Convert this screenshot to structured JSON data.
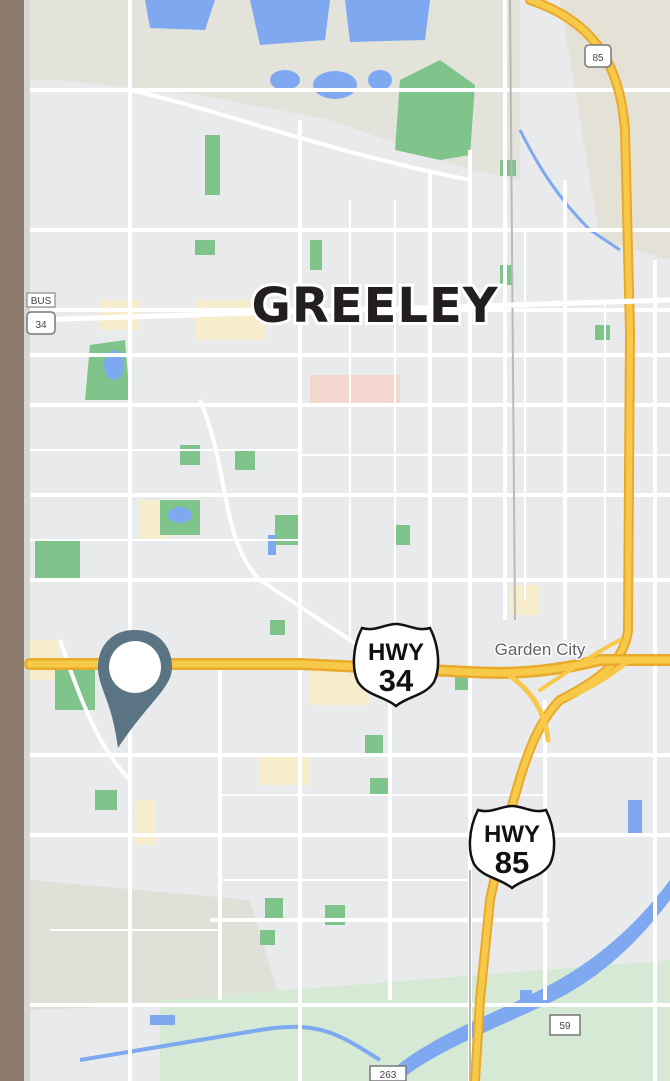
{
  "map": {
    "city_label": "GREELEY",
    "place_labels": [
      {
        "text": "Garden City"
      }
    ],
    "highway_shields": [
      {
        "prefix": "HWY",
        "number": "34"
      },
      {
        "prefix": "HWY",
        "number": "85"
      }
    ],
    "mini_shields": [
      {
        "text": "85"
      },
      {
        "text": "34"
      },
      {
        "text": "BUS"
      },
      {
        "text": "59"
      },
      {
        "text": "263"
      }
    ],
    "marker": {
      "icon": "location-pin-icon"
    },
    "colors": {
      "land": "#e9eaec",
      "road": "#ffffff",
      "highway": "#f7c948",
      "highway_edge": "#e9a92a",
      "water": "#7ea8ef",
      "park": "#7fc48b",
      "urban": "#f7eccb",
      "pin": "#5a7483"
    }
  }
}
